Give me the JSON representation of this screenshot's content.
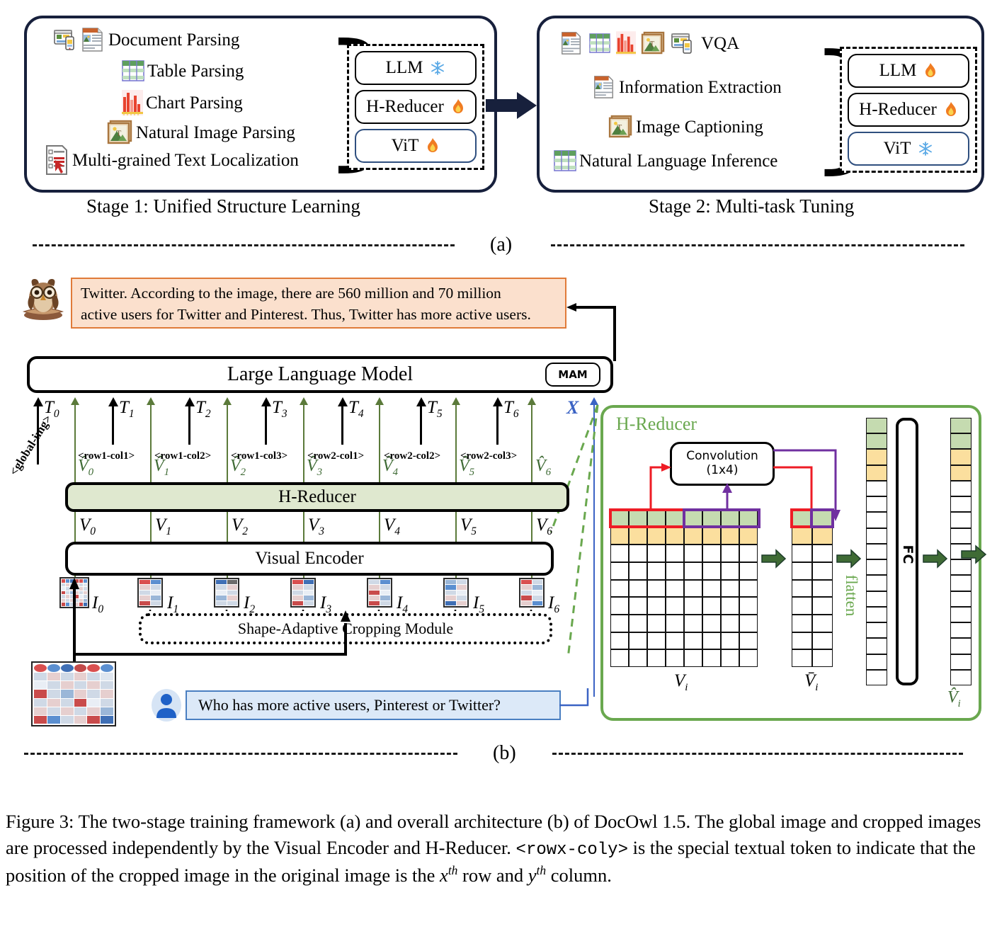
{
  "figure": {
    "panel_a_label": "(a)",
    "panel_b_label": "(b)"
  },
  "stage1": {
    "caption": "Stage 1: Unified Structure Learning",
    "tasks": [
      {
        "label": "Document Parsing",
        "icons": [
          "webpage-icon",
          "document-icon"
        ]
      },
      {
        "label": "Table Parsing",
        "icons": [
          "table-icon"
        ]
      },
      {
        "label": "Chart Parsing",
        "icons": [
          "bar-chart-icon"
        ]
      },
      {
        "label": "Natural Image Parsing",
        "icons": [
          "natural-image-icon"
        ]
      },
      {
        "label": "Multi-grained Text Localization",
        "icons": [
          "text-localization-icon"
        ]
      }
    ],
    "modules": [
      {
        "name": "LLM",
        "state": "frozen",
        "state_icon": "snowflake-icon"
      },
      {
        "name": "H-Reducer",
        "state": "trainable",
        "state_icon": "fire-icon"
      },
      {
        "name": "ViT",
        "state": "trainable",
        "state_icon": "fire-icon"
      }
    ]
  },
  "stage2": {
    "caption": "Stage 2: Multi-task Tuning",
    "tasks": [
      {
        "label": "VQA",
        "icons": [
          "document-icon",
          "table-icon",
          "bar-chart-icon",
          "natural-image-icon",
          "webpage-icon"
        ]
      },
      {
        "label": "Information Extraction",
        "icons": [
          "document-icon"
        ]
      },
      {
        "label": "Image Captioning",
        "icons": [
          "natural-image-icon"
        ]
      },
      {
        "label": "Natural Language Inference",
        "icons": [
          "table-icon"
        ]
      }
    ],
    "modules": [
      {
        "name": "LLM",
        "state": "trainable",
        "state_icon": "fire-icon"
      },
      {
        "name": "H-Reducer",
        "state": "trainable",
        "state_icon": "fire-icon"
      },
      {
        "name": "ViT",
        "state": "frozen",
        "state_icon": "snowflake-icon"
      }
    ]
  },
  "architecture": {
    "answer_line1": "Twitter. According to the image, there are 560 million and 70 million",
    "answer_line2": "active users for Twitter and Pinterest. Thus, Twitter has more active users.",
    "llm_label": "Large Language Model",
    "mam_label": "MAM",
    "h_reducer_label": "H-Reducer",
    "visual_encoder_label": "Visual Encoder",
    "cropping_module_label": "Shape-Adaptive  Cropping Module",
    "query_text": "Who has more active users, Pinterest or Twitter?",
    "x_label": "X",
    "global_img_token": "<global-img>",
    "text_tokens": [
      "T0",
      "T1",
      "T2",
      "T3",
      "T4",
      "T5",
      "T6"
    ],
    "text_token_bases": [
      "T",
      "T",
      "T",
      "T",
      "T",
      "T",
      "T"
    ],
    "text_token_subs": [
      "0",
      "1",
      "2",
      "3",
      "4",
      "5",
      "6"
    ],
    "rowcol_tokens": [
      "<row1-col1>",
      "<row1-col2>",
      "<row1-col3>",
      "<row2-col1>",
      "<row2-col2>",
      "<row2-col3>"
    ],
    "v_hat_subs": [
      "0",
      "1",
      "2",
      "3",
      "4",
      "5",
      "6"
    ],
    "v_subs": [
      "0",
      "1",
      "2",
      "3",
      "4",
      "5",
      "6"
    ],
    "i_subs": [
      "0",
      "1",
      "2",
      "3",
      "4",
      "5",
      "6"
    ]
  },
  "hreducer_detail": {
    "title": "H-Reducer",
    "conv_line1": "Convolution",
    "conv_line2": "(1x4)",
    "fc_label": "FC",
    "flatten_label": "flatten",
    "vi_label": "V",
    "vi_sub": "i",
    "vbar_label": "V̄",
    "vbar_sub": "i",
    "vhat_label": "V̂",
    "vhat_sub": "i",
    "grid_cols": 8,
    "grid_rows": 9,
    "strip_cells": 9,
    "flatten_cells": 17,
    "colors": {
      "panel_border": "#6aa84f",
      "green_cell": "#c5dbb0",
      "yellow_cell": "#fbdf9e",
      "red_box": "#ee1c25",
      "purple_box": "#7030a0",
      "arrow_green": "#3f6b35"
    }
  },
  "caption": {
    "part1": "Figure 3: The two-stage training framework (a) and overall architecture (b) of DocOwl 1.5. The global image and cropped images are processed independently by the Visual Encoder and H-Reducer. ",
    "token": "<rowx-coly>",
    "part2": " is the special textual token to indicate that the position of the cropped image in the original image is the ",
    "x_var": "x",
    "sup1": "th",
    "mid": " row and ",
    "y_var": "y",
    "sup2": "th",
    "part3": " column."
  },
  "colors": {
    "stage_border": "#17203c",
    "answer_bg": "#fbe0cd",
    "answer_border": "#e07b39",
    "query_bg": "#dce9f8",
    "query_border": "#4a7fc1",
    "hreducer_bg": "#dfe8cf",
    "green_line": "#5b7a3a",
    "blue_line": "#3b63c4"
  }
}
